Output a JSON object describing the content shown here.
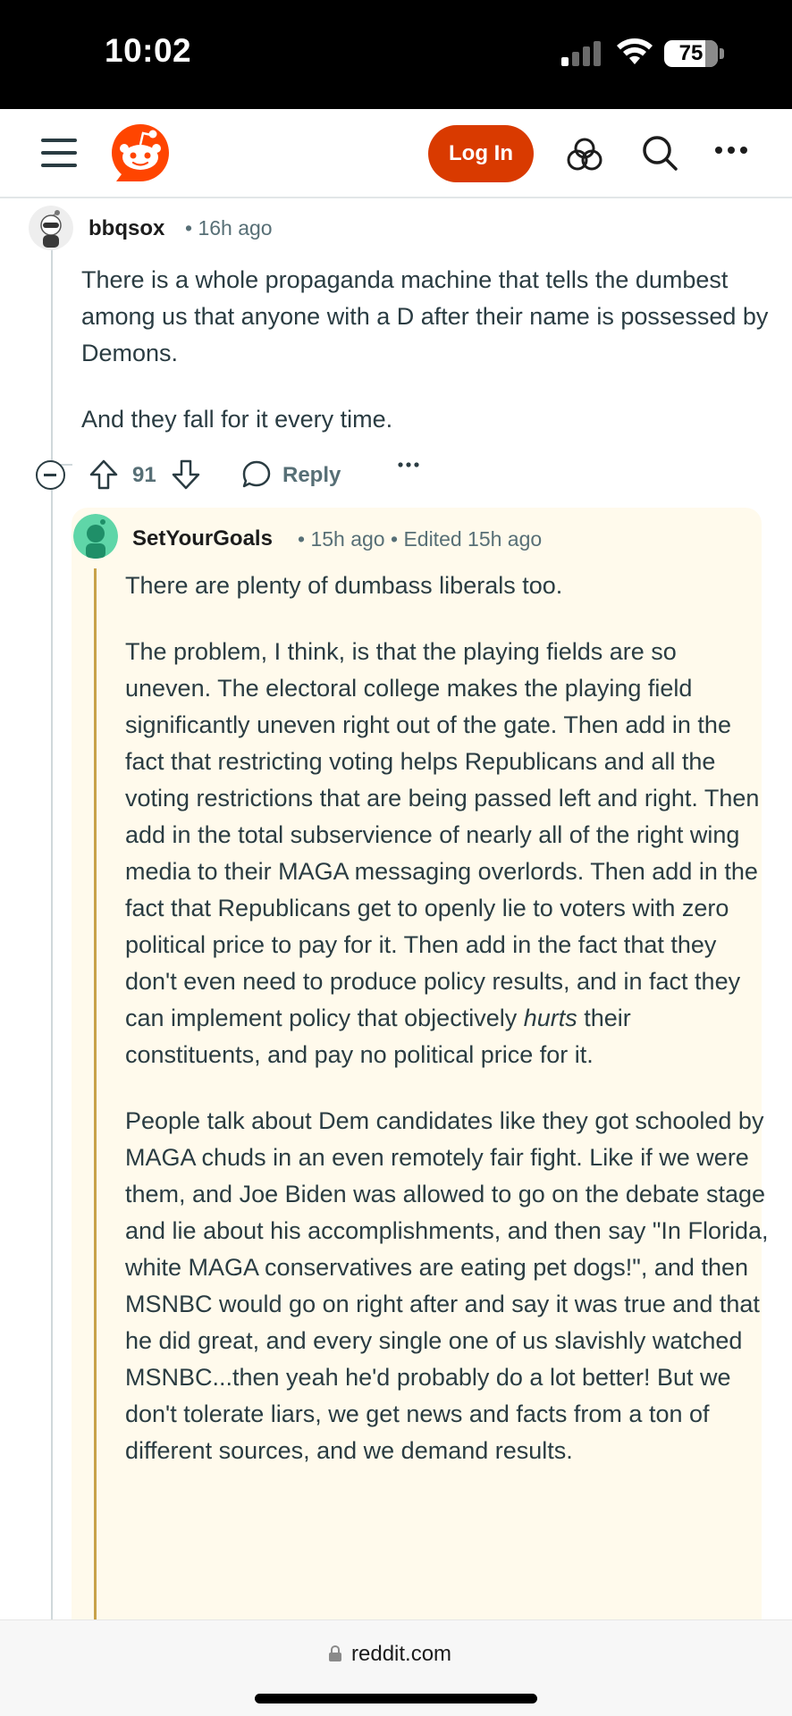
{
  "status_bar": {
    "time": "10:02",
    "battery": "75"
  },
  "nav": {
    "login_label": "Log In",
    "icons": [
      "menu-icon",
      "reddit-logo",
      "apps-icon",
      "search-icon",
      "more-icon"
    ],
    "brand_color": "#d93a00"
  },
  "comment": {
    "author": "bbqsox",
    "time": "16h ago",
    "paragraphs": [
      "There is a whole propaganda machine that tells the dumbest among us that anyone with a D after their name is possessed by Demons.",
      "And they fall for it every time."
    ],
    "score": "91",
    "reply_label": "Reply"
  },
  "reply": {
    "author": "SetYourGoals",
    "time": "15h ago",
    "edited": "Edited 15h ago",
    "p1": "There are plenty of dumbass liberals too.",
    "p2_before": "The problem, I think, is that the playing fields are so uneven. The electoral college makes the playing field significantly uneven right out of the gate. Then add in the fact that restricting voting helps Republicans and all the voting restrictions that are being passed left and right. Then add in the total subservience of nearly all of the right wing media to their MAGA messaging overlords. Then add in the fact that Republicans get to openly lie to voters with zero political price to pay for it. Then add in the fact that they don't even need to produce policy results, and in fact they can implement policy that objectively ",
    "p2_emphasis": "hurts",
    "p2_after": " their constituents, and pay no political price for it.",
    "p3": "People talk about Dem candidates like they got schooled by MAGA chuds in an even remotely fair fight. Like if we were them, and Joe Biden was allowed to go on the debate stage and lie about his accomplishments, and then say \"In Florida, white MAGA conservatives are eating pet dogs!\", and then MSNBC would go on right after and say it was true and that he did great, and every single one of us slavishly watched MSNBC...then yeah he'd probably do a lot better! But we don't tolerate liars, we get news and facts from a ton of different sources, and we demand results."
  },
  "browser": {
    "url": "reddit.com"
  }
}
